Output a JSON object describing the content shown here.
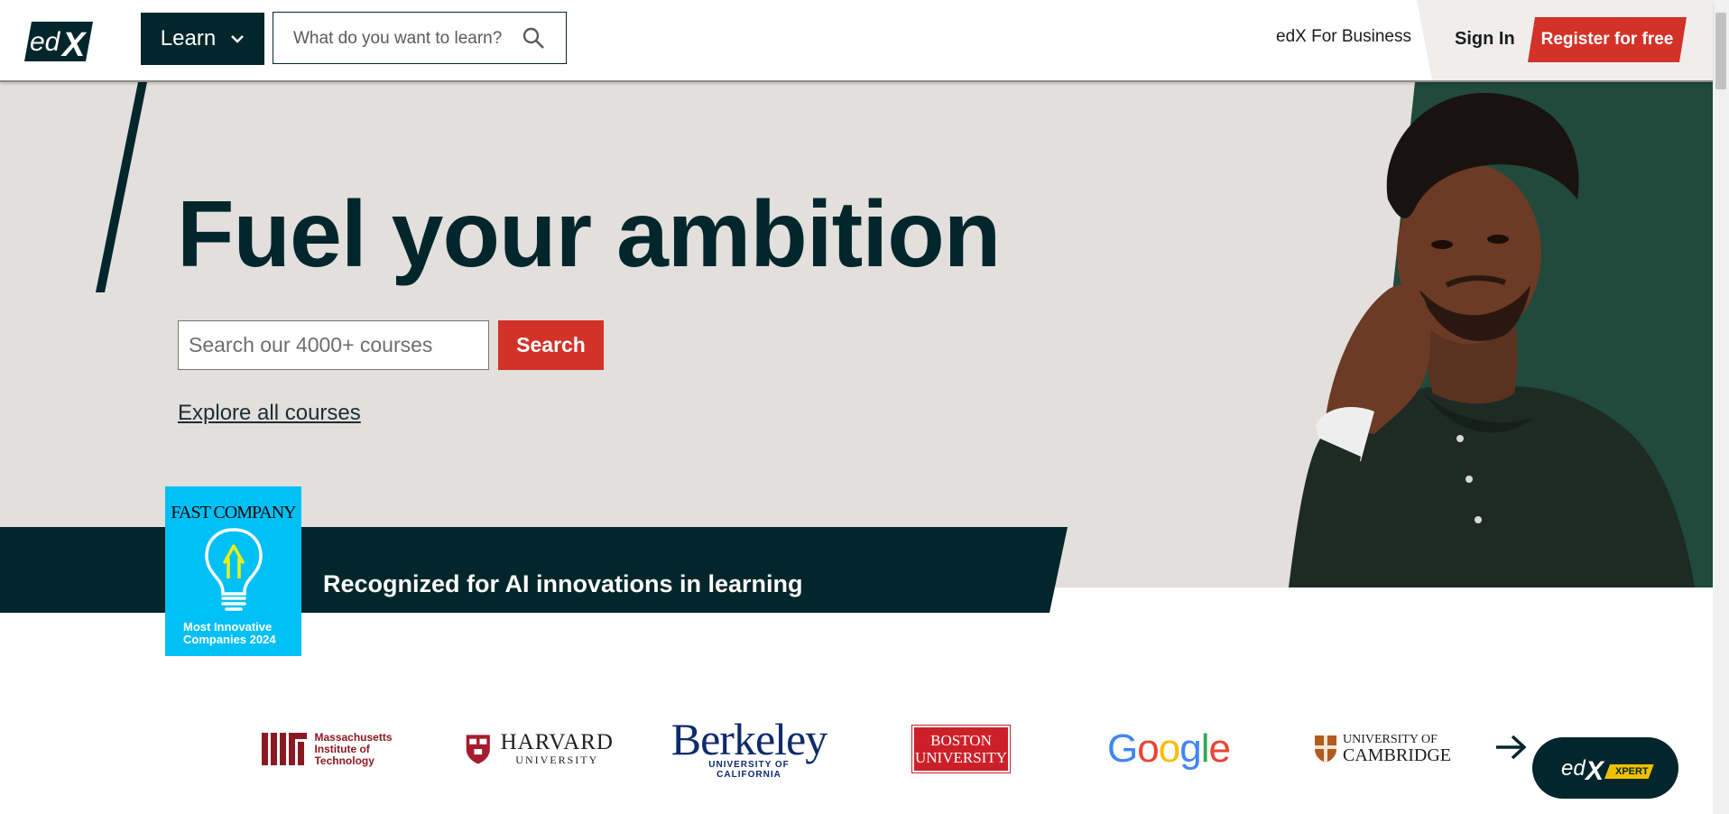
{
  "header": {
    "logo_text": "edX",
    "learn_label": "Learn",
    "search_placeholder": "What do you want to learn?",
    "business_label": "edX For Business",
    "signin_label": "Sign In",
    "register_label": "Register for free"
  },
  "hero": {
    "title": "Fuel your ambition",
    "search_placeholder": "Search our 4000+ courses",
    "search_button": "Search",
    "explore_link": "Explore all courses"
  },
  "banner": {
    "text": "Recognized for AI innovations in learning",
    "badge_brand": "FAST COMPANY",
    "badge_line1": "Most Innovative",
    "badge_line2": "Companies 2024"
  },
  "partners": {
    "mit": [
      "Massachusetts",
      "Institute of",
      "Technology"
    ],
    "harvard": {
      "name": "HARVARD",
      "sub": "UNIVERSITY"
    },
    "berkeley": {
      "name": "Berkeley",
      "sub": "UNIVERSITY OF CALIFORNIA"
    },
    "boston": {
      "line1": "BOSTON",
      "line2": "UNIVERSITY"
    },
    "google": "Google",
    "cambridge": {
      "line1": "UNIVERSITY OF",
      "line2": "CAMBRIDGE"
    }
  },
  "xpert": {
    "logo_text": "edX",
    "label": "XPERT"
  },
  "colors": {
    "brand_dark": "#02262b",
    "accent_red": "#d23228",
    "hero_bg": "#e2dfdc",
    "badge_blue": "#00c0f5"
  },
  "icons": [
    "edx-logo",
    "chevron-down-icon",
    "search-icon",
    "arrow-right-icon",
    "lightbulb-icon",
    "harvard-shield-icon",
    "cambridge-shield-icon"
  ]
}
